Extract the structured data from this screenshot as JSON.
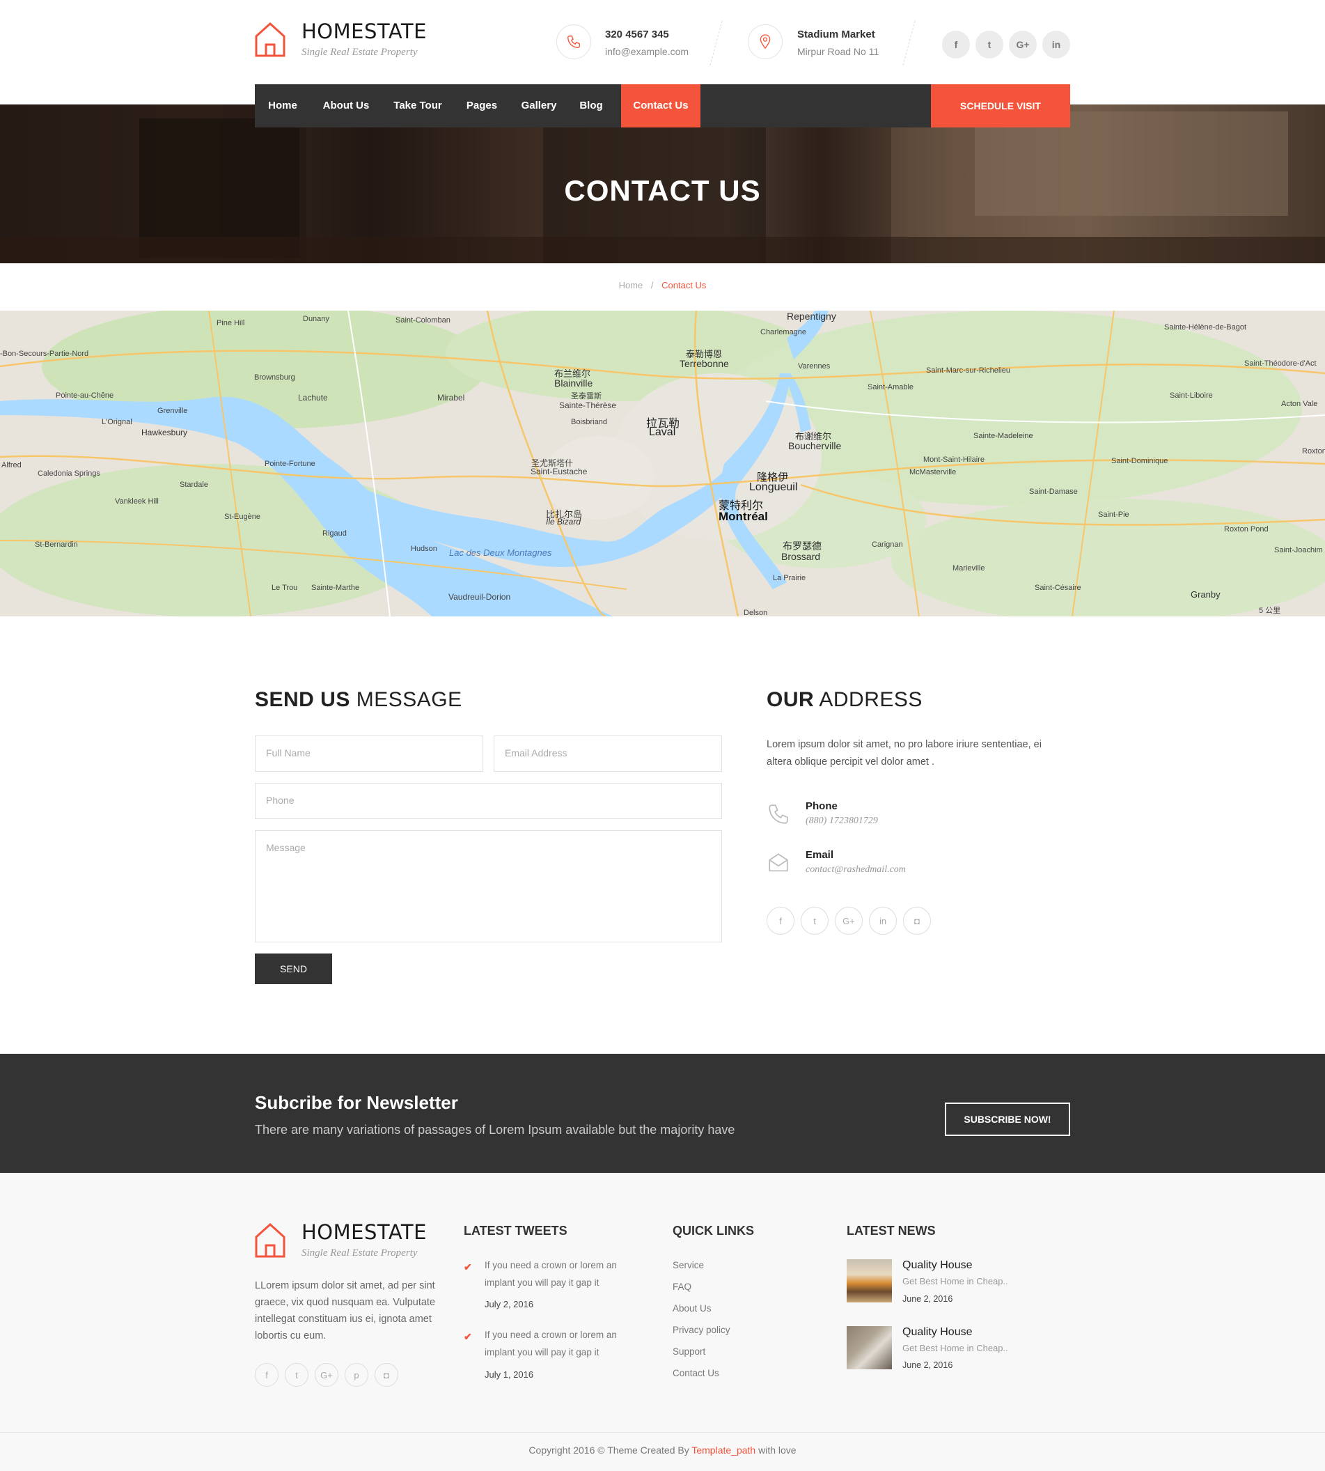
{
  "brand": {
    "name": "HOMESTATE",
    "tagline": "Single Real Estate Property",
    "accent": "#f4543b"
  },
  "header_contact": {
    "phone": "320 4567 345",
    "email": "info@example.com",
    "location_title": "Stadium Market",
    "location_sub": "Mirpur Road No 11"
  },
  "top_social": [
    "f",
    "t",
    "G+",
    "in"
  ],
  "nav": {
    "items": [
      "Home",
      "About Us",
      "Take Tour",
      "Pages",
      "Gallery",
      "Blog",
      "Contact Us"
    ],
    "active": "Contact Us",
    "cta": "SCHEDULE VISIT"
  },
  "hero": {
    "title": "CONTACT US"
  },
  "breadcrumb": {
    "home": "Home",
    "sep": "/",
    "current": "Contact Us"
  },
  "map": {
    "labels": [
      "Repentigny",
      "Charlemagne",
      "泰勒博恩",
      "Terrebonne",
      "布兰维尔",
      "Blainville",
      "圣泰雷斯",
      "Sainte-Thérèse",
      "Boisbriand",
      "拉瓦勒",
      "Laval",
      "布谢维尔",
      "Boucherville",
      "隆格伊",
      "Longueuil",
      "蒙特利尔",
      "Montréal",
      "布罗瑟德",
      "Brossard",
      "圣尤斯塔什",
      "Saint-Eustache",
      "比扎尔岛",
      "Île Bizard",
      "Lac des Deux Montagnes",
      "Vaudreuil-Dorion",
      "Hudson",
      "Rigaud",
      "Pointe-Fortune",
      "Hawkesbury",
      "Grenville",
      "L'Orignal",
      "Pointe-au-Chêne",
      "Lachute",
      "Mirabel",
      "Brownsburg",
      "Pine Hill",
      "Dunany",
      "Saint-Colomban",
      "Varennes",
      "Saint-Amable",
      "Mont-Saint-Hilaire",
      "McMasterville",
      "Sainte-Madeleine",
      "Saint-Damase",
      "Saint-Pie",
      "Roxton Pond",
      "Granby",
      "Marieville",
      "Saint-Césaire",
      "La Prairie",
      "Carignan",
      "Saint-Dominique",
      "Sainte-Hélène-de-Bagot",
      "Saint-Marc-sur-Richelieu",
      "Saint-Liboire",
      "Vankleek Hill",
      "Stardale",
      "St-Eugène",
      "Caledonia Springs",
      "St-Bernardin",
      "Alfred",
      "Le Trou",
      "Sainte-Marthe",
      "Delson",
      "Acton Vale",
      "Saint-Théodore-d'Act",
      "-Bon-Secours-Partie-Nord",
      "Saint-Joachim",
      "Roxton",
      "5 公里"
    ]
  },
  "send_message": {
    "title_bold": "SEND US",
    "title_light": "MESSAGE",
    "full_name_placeholder": "Full Name",
    "email_placeholder": "Email Address",
    "phone_placeholder": "Phone",
    "message_placeholder": "Message",
    "send_label": "SEND"
  },
  "address": {
    "title_bold": "OUR",
    "title_light": "ADDRESS",
    "text": "Lorem ipsum dolor sit amet, no pro labore iriure sententiae, ei altera oblique percipit vel dolor amet .",
    "phone_label": "Phone",
    "phone_value": "(880) 1723801729",
    "email_label": "Email",
    "email_value": "contact@rashedmail.com"
  },
  "address_social": [
    "f",
    "t",
    "G+",
    "in",
    "◘"
  ],
  "newsletter": {
    "title": "Subcribe for Newsletter",
    "text": "There are many variations of passages of Lorem Ipsum available but the majority have",
    "button": "SUBSCRIBE NOW!"
  },
  "footer": {
    "about": "LLorem ipsum dolor sit amet, ad per sint graece, vix quod nusquam ea. Vulputate intellegat constituam ius ei, ignota amet lobortis cu eum.",
    "social": [
      "f",
      "t",
      "G+",
      "p",
      "◘"
    ],
    "tweets_title": "LATEST TWEETS",
    "tweets": [
      {
        "line1": "If you need a crown or lorem an",
        "line2": "implant you will pay it gap it",
        "date": "July 2, 2016"
      },
      {
        "line1": "If you need a crown or lorem an",
        "line2": "implant you will pay it gap it",
        "date": "July 1, 2016"
      }
    ],
    "links_title": "QUICK LINKS",
    "links": [
      "Service",
      "FAQ",
      "About Us",
      "Privacy policy",
      "Support",
      "Contact Us"
    ],
    "news_title": "LATEST NEWS",
    "news": [
      {
        "title": "Quality House",
        "sub": "Get Best Home in Cheap..",
        "date": "June 2, 2016"
      },
      {
        "title": "Quality House",
        "sub": "Get Best Home in Cheap..",
        "date": "June 2, 2016"
      }
    ],
    "copyright_pre": "Copyright 2016 © Theme Created By",
    "copyright_link": "Template_path",
    "copyright_post": "with love"
  }
}
